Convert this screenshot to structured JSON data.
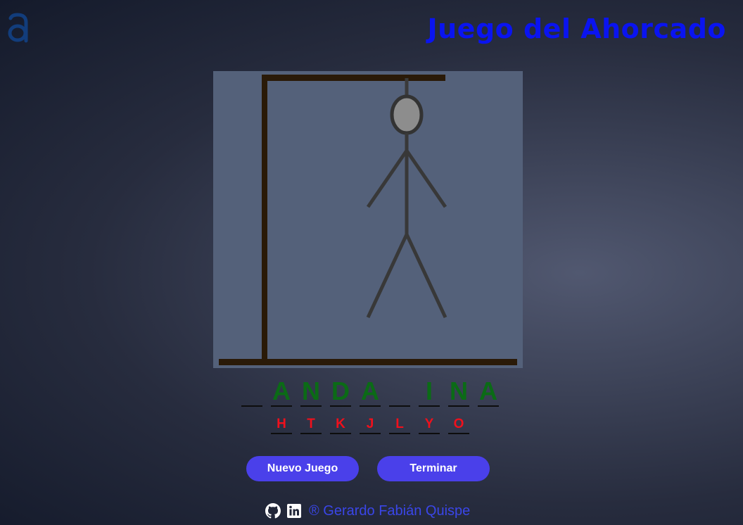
{
  "header": {
    "logo_icon": "alura-a-logo-icon",
    "title": "Juego del Ahorcado",
    "title_color": "#0a14f0"
  },
  "game": {
    "board_color": "#54617a",
    "word_letters": [
      "",
      "A",
      "N",
      "D",
      "A",
      "",
      "I",
      "N",
      "A"
    ],
    "correct_color": "#0b6b16",
    "wrong_letters": [
      "H",
      "T",
      "K",
      "J",
      "L",
      "Y",
      "O"
    ],
    "wrong_color": "#f0101c"
  },
  "buttons": {
    "new_game_label": "Nuevo Juego",
    "end_label": "Terminar",
    "accent": "#4a40ea"
  },
  "footer": {
    "github_icon": "github-icon",
    "linkedin_icon": "linkedin-icon",
    "credit": "® Gerardo Fabián Quispe"
  }
}
